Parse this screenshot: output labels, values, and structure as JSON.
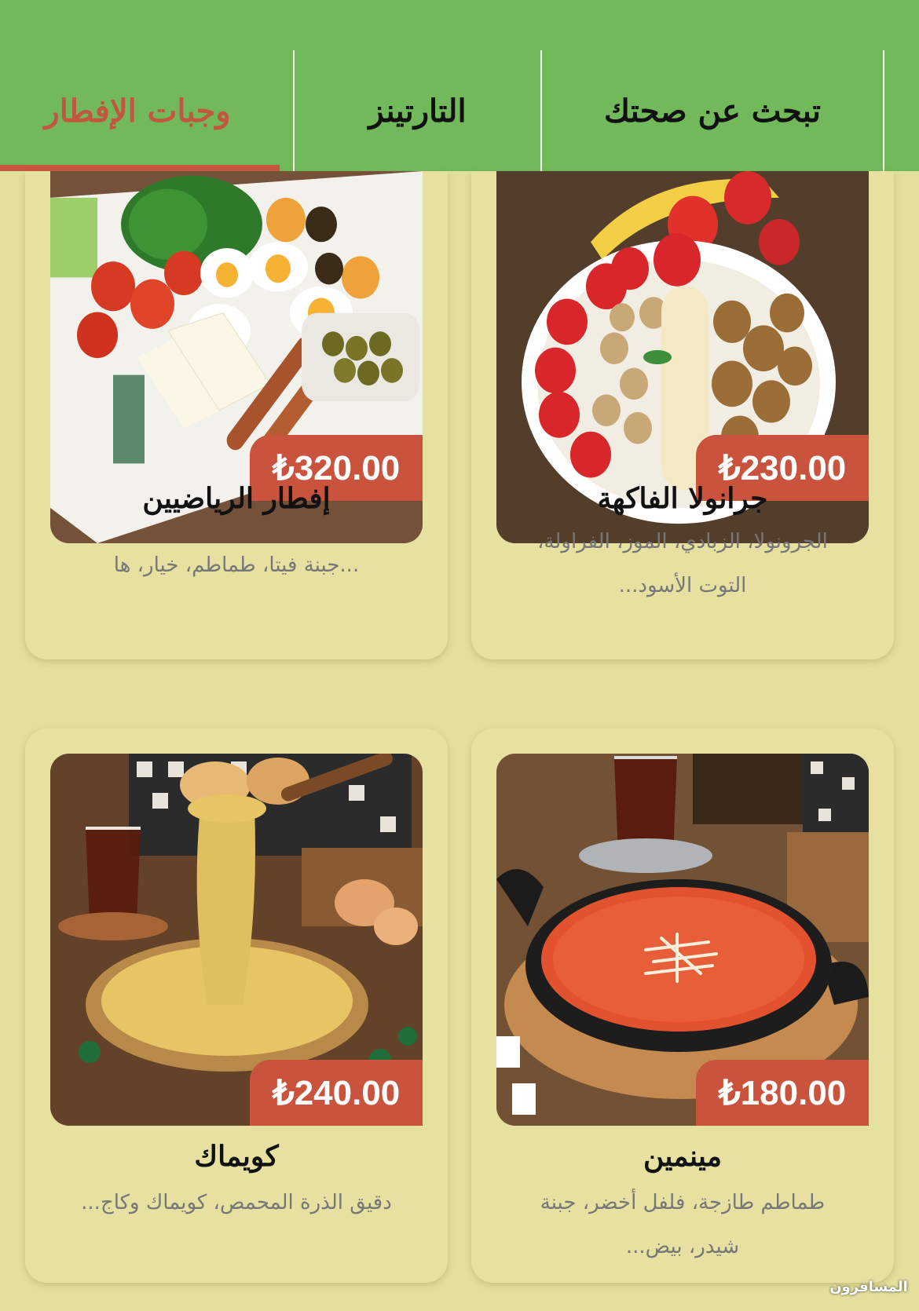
{
  "tabs": [
    {
      "label": "وجبات الإفطار",
      "active": true
    },
    {
      "label": "التارتينز",
      "active": false
    },
    {
      "label": "تبحث عن صحتك",
      "active": false
    }
  ],
  "products": [
    {
      "name": "إفطار الرياضيين",
      "price": "₺320.00",
      "description": "...جبنة فيتا، طماطم، خيار، ها",
      "image": "breakfast-plate"
    },
    {
      "name": "جرانولا الفاكهة",
      "price": "₺230.00",
      "description": "الجرونولا، الزبادي، الموز، الفراولة، التوت الأسود...",
      "image": "granola-bowl"
    },
    {
      "name": "كويماك",
      "price": "₺240.00",
      "description": "دقيق الذرة المحمص، كويماك وكاج...",
      "image": "kuymak-pan"
    },
    {
      "name": "مينمين",
      "price": "₺180.00",
      "description": "طماطم طازجة، فلفل أخضر، جبنة شيدر، بيض...",
      "image": "menemen-pan"
    }
  ],
  "watermark": "المسافرون",
  "colors": {
    "tabbar": "#72b95c",
    "accent": "#c8573f",
    "background": "#e3df9c",
    "card": "#e6e1a0"
  }
}
